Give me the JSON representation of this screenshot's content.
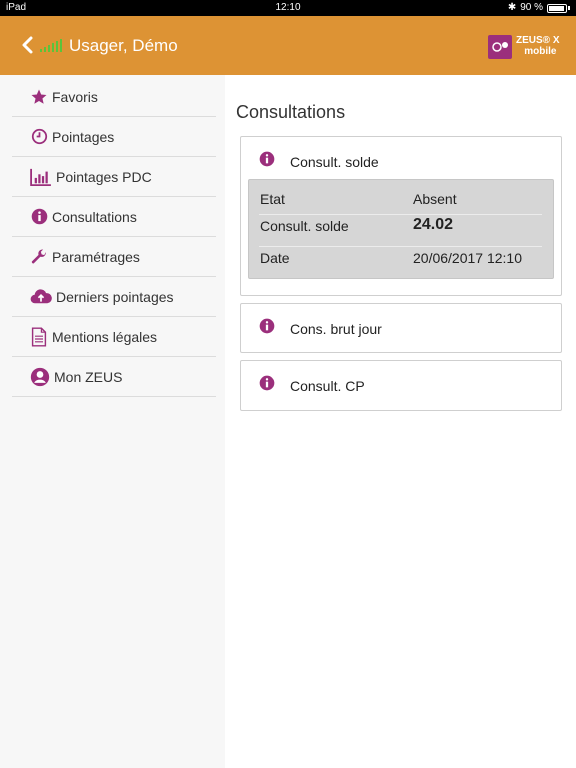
{
  "status_bar": {
    "device": "iPad",
    "time": "12:10",
    "battery": "90 %"
  },
  "header": {
    "title": "Usager, Démo",
    "logo_text": "ZEUS® X",
    "logo_sub": "mobile"
  },
  "sidebar": {
    "items": [
      {
        "label": "Favoris",
        "icon": "star-icon"
      },
      {
        "label": "Pointages",
        "icon": "clock-icon"
      },
      {
        "label": "Pointages PDC",
        "icon": "bar-chart-icon"
      },
      {
        "label": "Consultations",
        "icon": "info-icon"
      },
      {
        "label": "Paramétrages",
        "icon": "wrench-icon"
      },
      {
        "label": "Derniers pointages",
        "icon": "cloud-upload-icon"
      },
      {
        "label": "Mentions légales",
        "icon": "document-icon"
      },
      {
        "label": "Mon ZEUS",
        "icon": "user-icon"
      }
    ]
  },
  "main": {
    "title": "Consultations",
    "cards": [
      {
        "title": "Consult. solde",
        "details": [
          {
            "label": "Etat",
            "value": "Absent"
          },
          {
            "label": "Consult. solde",
            "value": "24.02"
          },
          {
            "label": "Date",
            "value": "20/06/2017 12:10"
          }
        ]
      },
      {
        "title": "Cons. brut jour"
      },
      {
        "title": "Consult. CP"
      }
    ]
  },
  "colors": {
    "accent": "#dd9334",
    "icon": "#9b2f7c",
    "signal": "#5cc33b"
  }
}
